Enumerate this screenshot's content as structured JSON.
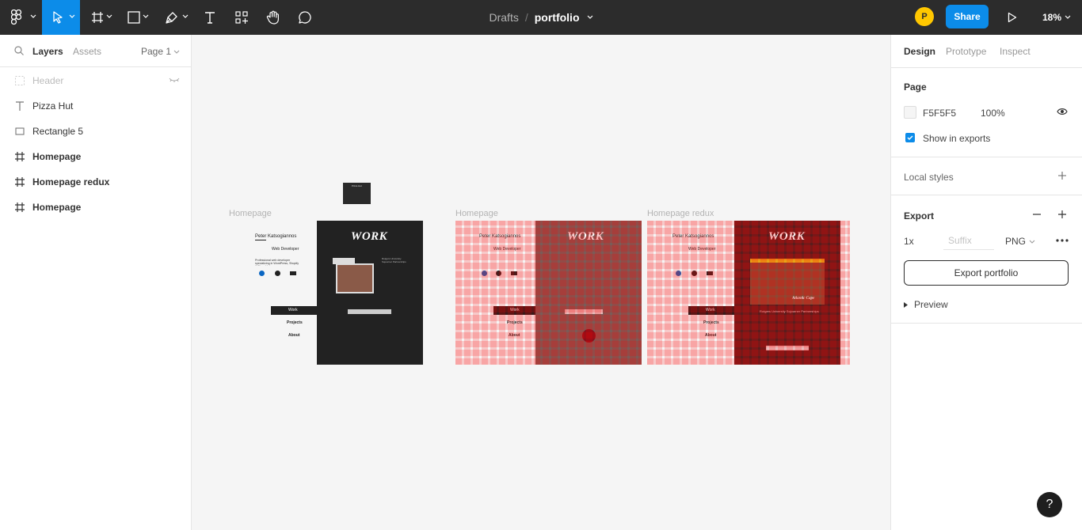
{
  "toolbar": {
    "breadcrumb_parent": "Drafts",
    "breadcrumb_sep": "/",
    "file_name": "portfolio",
    "avatar_initial": "P",
    "share_label": "Share",
    "zoom_level": "18%"
  },
  "left_panel": {
    "tab_layers": "Layers",
    "tab_assets": "Assets",
    "page_select": "Page 1",
    "layers": [
      {
        "label": "Header",
        "icon": "frame-dashed-icon",
        "hidden": true
      },
      {
        "label": "Pizza Hut",
        "icon": "text-icon"
      },
      {
        "label": "Rectangle 5",
        "icon": "rectangle-icon"
      },
      {
        "label": "Homepage",
        "icon": "frame-icon"
      },
      {
        "label": "Homepage redux",
        "icon": "frame-icon"
      },
      {
        "label": "Homepage",
        "icon": "frame-icon"
      }
    ]
  },
  "right_panel": {
    "tab_design": "Design",
    "tab_prototype": "Prototype",
    "tab_inspect": "Inspect",
    "page_title": "Page",
    "page_color": "F5F5F5",
    "page_opacity": "100%",
    "show_in_exports": "Show in exports",
    "local_styles": "Local styles",
    "export_title": "Export",
    "export_scale": "1x",
    "suffix_placeholder": "Suffix",
    "export_format": "PNG",
    "export_button": "Export portfolio",
    "preview_label": "Preview"
  },
  "canvas": {
    "label_homepage_1": "Homepage",
    "label_homepage_2": "Homepage",
    "label_homepage_redux": "Homepage redux",
    "pizza_hut_text": "Pizza Hut",
    "site": {
      "name": "Peter Katsogiannos",
      "role": "Web Developer",
      "blurb": "Professional web developer specializing in WordPress, Shopify & Pizza Hut",
      "nav_work": "Work",
      "nav_projects": "Projects",
      "nav_about": "About",
      "work_heading": "WORK",
      "project_title": "Rutgers University Sojourner Partnerships",
      "atlantic_cape": "Atlantic Cape",
      "button": "Live Site"
    }
  },
  "colors": {
    "toolbar_bg": "#2c2c2c",
    "accent": "#0c8ce9",
    "avatar": "#ffc700",
    "canvas_bg": "#f5f5f5",
    "dark_frame": "#222222",
    "redux_frame": "#5a1d1d"
  },
  "help_label": "?"
}
